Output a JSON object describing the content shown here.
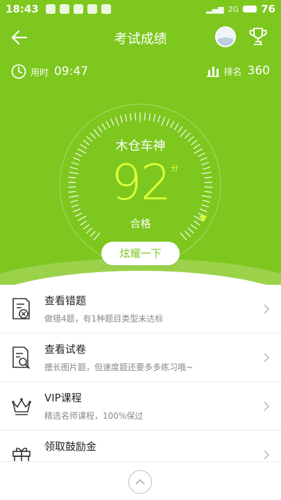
{
  "status_bar": {
    "time": "18:43",
    "signal_text": "2G",
    "battery_level": "76"
  },
  "header": {
    "title": "考试成绩"
  },
  "stats": {
    "time_label": "用时",
    "time_value": "09:47",
    "rank_label": "排名",
    "rank_value": "360"
  },
  "result": {
    "nickname": "木仓车神",
    "score": "92",
    "score_unit": "分",
    "status": "合格",
    "share_label": "炫耀一下"
  },
  "items": [
    {
      "icon": "wrong-questions-icon",
      "title": "查看错题",
      "subtitle": "做错4题，有1种题目类型未达标"
    },
    {
      "icon": "exam-paper-icon",
      "title": "查看试卷",
      "subtitle": "擅长图片题，但速度题还要多多练习哦~"
    },
    {
      "icon": "crown-icon",
      "title": "VIP课程",
      "subtitle": "精选名师课程，100%保过"
    },
    {
      "icon": "gift-icon",
      "title": "领取鼓励金",
      "subtitle": ""
    }
  ],
  "colors": {
    "brand_green": "#7dc71e",
    "score_yellow": "#d8ff3c"
  }
}
